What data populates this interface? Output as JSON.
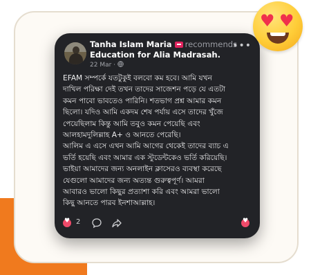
{
  "post": {
    "author_name": "Tanha Islam Maria",
    "action_text": "recommends",
    "page_name": "Education for Alia Madrasah.",
    "date": "22 Mar",
    "date_separator": "·",
    "more_icon": "more-dots-icon",
    "globe_icon": "globe-icon",
    "body_paragraph_1": "EFAM সম্পর্কে যতটুকুই বলবো কম হবে। আমি যখন\nদাখিল পরিক্ষা দেই তখন তাদের সাজেশন পড়ে যে এতটা\nকমন পাবো ভাবতেও পারিনি। শতভাগ প্রশ্ন আমার কমন\nছিলো। যদিও আমি একদম শেষ পর্যায় এসে তাদের খুঁজে\nপেয়েছিলাম কিন্তু আমি তবুও কমন পেয়েছি এবং\nআলহামদুলিল্লাহ A+ ও আনতে পেরেছি।",
    "body_paragraph_2": "আলিম এ এসে এখন আমি আগের থেকেই তাদের ব্যাচ এ\nভর্তি হয়েছি এবং আমার এক স্টুডেন্টকেও ভর্তি করিয়েছি।\nভাইয়া আমাদের জন্য অনলাইন ক্লাসেরও ব্যবস্থা করেছে\nযেগুলো আমাদের জন্য অত্যন্ত গুরুত্বপূর্ণ। আমরা\nআবারও ভালো কিছুর প্রত্যাশা করি এবং আমরা ভালো\nকিছু আনতে পারব ইনশাআল্লাহ।"
  },
  "footer": {
    "reaction_count": "2",
    "reaction_icon": "love-reaction-icon",
    "comment_icon": "comment-icon",
    "share_icon": "share-icon",
    "react_icon": "love-react-icon"
  },
  "decoration": {
    "emoji": "heart-eyes-emoji",
    "accent_color": "#f07a1e",
    "card_color": "#222327"
  }
}
